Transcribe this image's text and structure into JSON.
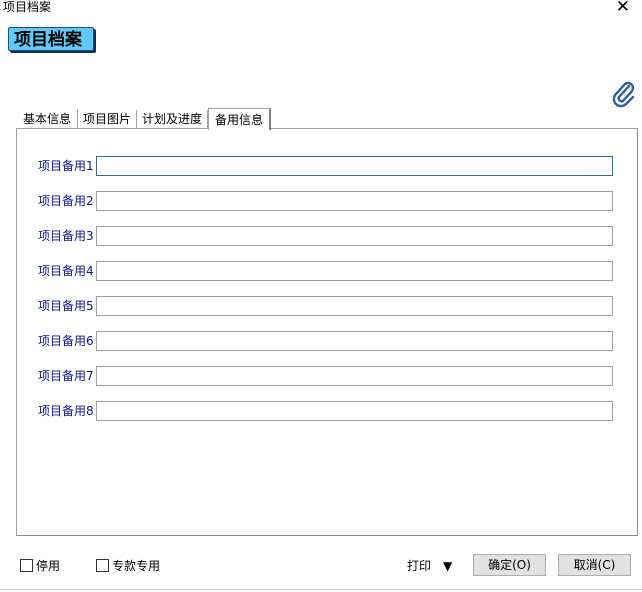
{
  "window": {
    "title": "项目档案",
    "close_glyph": "✕"
  },
  "header": {
    "title": "项目档案"
  },
  "tabs": [
    {
      "label": "基本信息",
      "active": false
    },
    {
      "label": "项目图片",
      "active": false
    },
    {
      "label": "计划及进度",
      "active": false
    },
    {
      "label": "备用信息",
      "active": true
    }
  ],
  "fields": [
    {
      "label": "项目备用1",
      "value": ""
    },
    {
      "label": "项目备用2",
      "value": ""
    },
    {
      "label": "项目备用3",
      "value": ""
    },
    {
      "label": "项目备用4",
      "value": ""
    },
    {
      "label": "项目备用5",
      "value": ""
    },
    {
      "label": "项目备用6",
      "value": ""
    },
    {
      "label": "项目备用7",
      "value": ""
    },
    {
      "label": "项目备用8",
      "value": ""
    }
  ],
  "footer": {
    "disable_label": "停用",
    "dedicated_label": "专款专用",
    "print_label": "打印",
    "print_arrow": "▼",
    "ok_label": "确定(O)",
    "cancel_label": "取消(C)"
  },
  "icons": {
    "attachment": "paperclip-icon"
  },
  "colors": {
    "header_bg": "#61c9f8",
    "label_text": "#101880",
    "clip_icon": "#2b5f9e"
  }
}
